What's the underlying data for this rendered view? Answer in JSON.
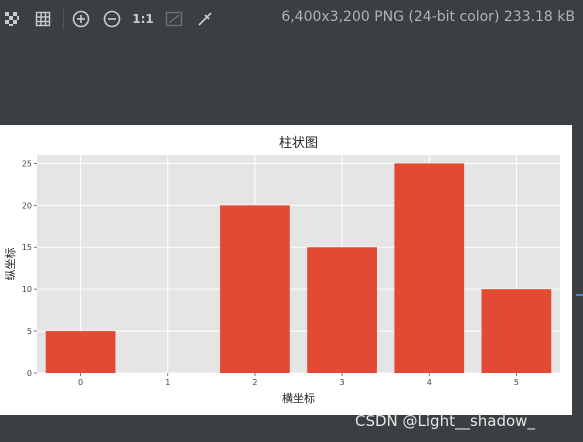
{
  "toolbar": {
    "icons": [
      "chessboard-icon",
      "grid-icon",
      "zoom-in-icon",
      "zoom-out-icon",
      "actual-size-icon",
      "fit-window-icon",
      "color-picker-icon"
    ],
    "ratio_label": "1:1",
    "image_info": "6,400x3,200 PNG (24-bit color) 233.18 kB"
  },
  "watermark": "CSDN @Light__shadow_",
  "colors": {
    "background": "#3c3f41",
    "plot_bg": "#e5e5e5",
    "bar": "#e24a33",
    "grid": "#ffffff"
  },
  "chart_data": {
    "type": "bar",
    "title": "柱状图",
    "xlabel": "横坐标",
    "ylabel": "纵坐标",
    "x": [
      0,
      2,
      3,
      4,
      5
    ],
    "values": [
      5,
      20,
      15,
      25,
      10
    ],
    "xticks": [
      "0",
      "1",
      "2",
      "3",
      "4",
      "5"
    ],
    "yticks": [
      "0",
      "5",
      "10",
      "15",
      "20",
      "25"
    ],
    "xlim": [
      -0.5,
      5.5
    ],
    "ylim": [
      0,
      26
    ],
    "grid": true
  }
}
